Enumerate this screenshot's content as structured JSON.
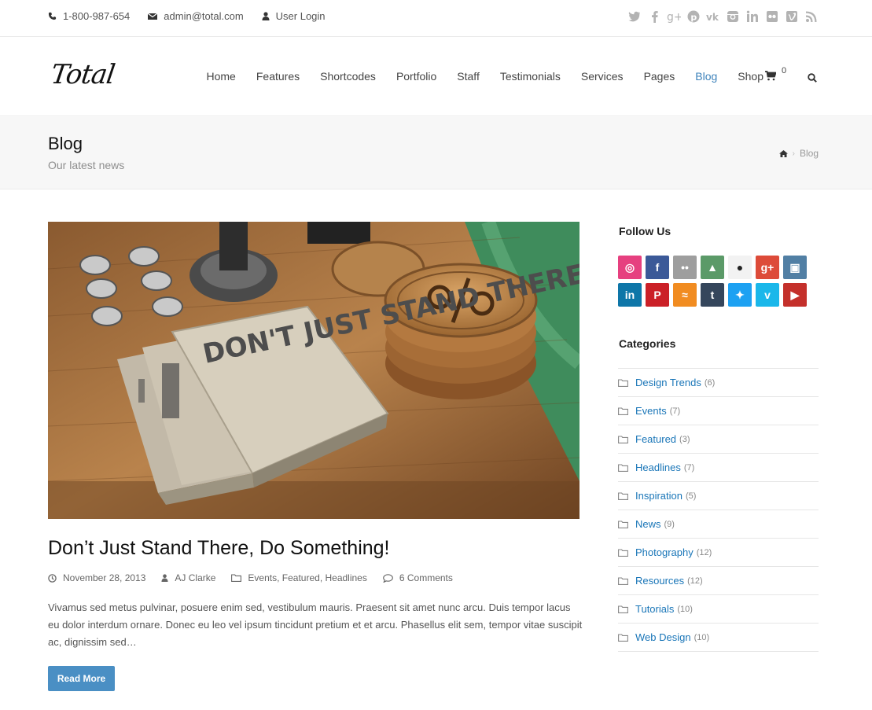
{
  "topbar": {
    "phone": "1-800-987-654",
    "email": "admin@total.com",
    "login": "User Login",
    "social": [
      "twitter-icon",
      "facebook-icon",
      "google-plus-icon",
      "pinterest-icon",
      "vk-icon",
      "instagram-icon",
      "linkedin-icon",
      "flickr-icon",
      "vimeo-icon",
      "rss-icon"
    ]
  },
  "header": {
    "logo": "Total",
    "nav": [
      "Home",
      "Features",
      "Shortcodes",
      "Portfolio",
      "Staff",
      "Testimonials",
      "Services",
      "Pages",
      "Blog",
      "Shop"
    ],
    "active_nav": "Blog",
    "cart_count": "0"
  },
  "page_header": {
    "title": "Blog",
    "subtitle": "Our latest news",
    "breadcrumb": [
      "Blog"
    ]
  },
  "post": {
    "title": "Don’t Just Stand There, Do Something!",
    "notebook_text": "DON'T JUST STAND THERE",
    "date": "November 28, 2013",
    "author": "AJ Clarke",
    "categories": [
      "Events",
      "Featured",
      "Headlines"
    ],
    "comments": "6 Comments",
    "excerpt": "Vivamus sed metus pulvinar, posuere enim sed, vestibulum mauris. Praesent sit amet nunc arcu. Duis tempor lacus eu dolor interdum ornare. Donec eu leo vel ipsum tincidunt pretium et et arcu. Phasellus elit sem, tempor vitae suscipit ac, dignissim sed…",
    "read_more": "Read More"
  },
  "sidebar": {
    "follow_title": "Follow Us",
    "social_buttons": [
      {
        "name": "dribbble",
        "color": "#e6407f",
        "glyph": "◎"
      },
      {
        "name": "facebook",
        "color": "#3b5998",
        "glyph": "f"
      },
      {
        "name": "flickr",
        "color": "#9e9e9e",
        "glyph": "••"
      },
      {
        "name": "forrst",
        "color": "#5b9a68",
        "glyph": "▲"
      },
      {
        "name": "github",
        "color": "#f2f2f2",
        "glyph": "●"
      },
      {
        "name": "google-plus",
        "color": "#dd4b39",
        "glyph": "g+"
      },
      {
        "name": "instagram",
        "color": "#517fa4",
        "glyph": "▣"
      },
      {
        "name": "linkedin",
        "color": "#0e76a8",
        "glyph": "in"
      },
      {
        "name": "pinterest",
        "color": "#cb2027",
        "glyph": "P"
      },
      {
        "name": "rss",
        "color": "#f18c21",
        "glyph": "≈"
      },
      {
        "name": "tumblr",
        "color": "#35465c",
        "glyph": "t"
      },
      {
        "name": "twitter",
        "color": "#1da1f2",
        "glyph": "✦"
      },
      {
        "name": "vimeo",
        "color": "#1ab7ea",
        "glyph": "v"
      },
      {
        "name": "youtube",
        "color": "#c4302b",
        "glyph": "▶"
      }
    ],
    "categories_title": "Categories",
    "categories": [
      {
        "name": "Design Trends",
        "count": "(6)"
      },
      {
        "name": "Events",
        "count": "(7)"
      },
      {
        "name": "Featured",
        "count": "(3)"
      },
      {
        "name": "Headlines",
        "count": "(7)"
      },
      {
        "name": "Inspiration",
        "count": "(5)"
      },
      {
        "name": "News",
        "count": "(9)"
      },
      {
        "name": "Photography",
        "count": "(12)"
      },
      {
        "name": "Resources",
        "count": "(12)"
      },
      {
        "name": "Tutorials",
        "count": "(10)"
      },
      {
        "name": "Web Design",
        "count": "(10)"
      }
    ]
  },
  "colors": {
    "accent": "#3e83bb",
    "link": "#1a76b8",
    "button": "#4a8fc4"
  }
}
